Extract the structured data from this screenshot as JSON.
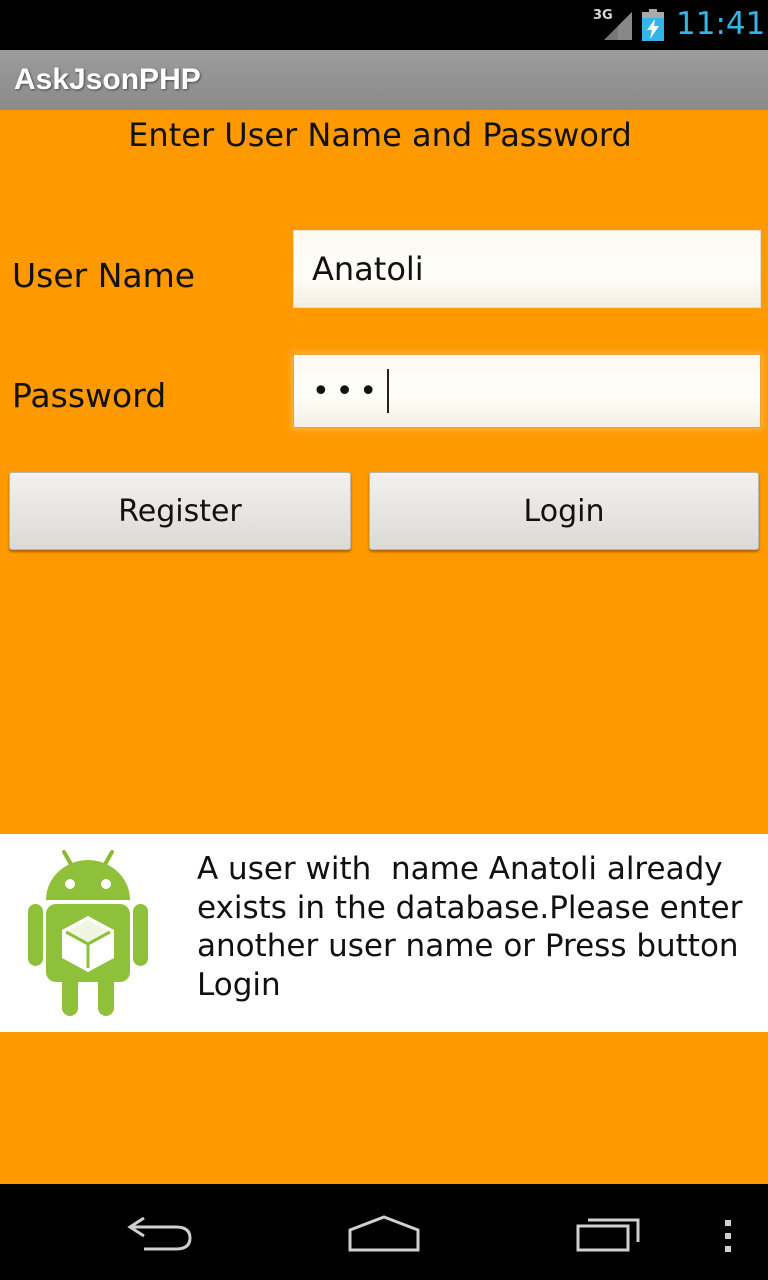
{
  "status_bar": {
    "network": "3G",
    "time": "11:41",
    "icons": [
      "signal-icon",
      "battery-charging-icon"
    ]
  },
  "app": {
    "title": "AskJsonPHP"
  },
  "form": {
    "heading": "Enter User Name and Password",
    "user_label": "User Name",
    "user_value": "Anatoli",
    "password_label": "Password",
    "password_value": "•••",
    "register_label": "Register",
    "login_label": "Login"
  },
  "toast": {
    "icon": "android-robot-icon",
    "message": "A user with  name Anatoli already exists in the database.Please enter another user name or Press button Login"
  },
  "nav_bar": {
    "icons": [
      "back-icon",
      "home-icon",
      "recent-apps-icon",
      "menu-overflow-icon"
    ]
  },
  "colors": {
    "background": "#ff9900",
    "action_bar": "#929292",
    "clock": "#33b5e5"
  }
}
